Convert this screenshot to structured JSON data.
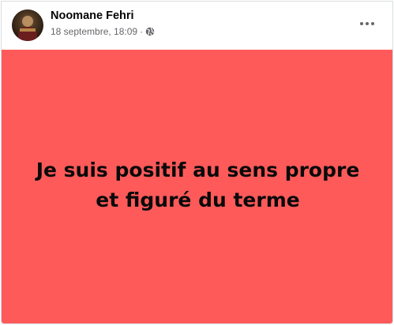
{
  "post": {
    "author": "Noomane Fehri",
    "timestamp": "18 septembre, 18:09",
    "separator": "·",
    "privacy_icon": "globe-icon",
    "more_icon": "more-horizontal-icon",
    "background_color": "#ff5a5a",
    "text_lines": [
      "Je suis positif au sens propre",
      "et figuré du terme"
    ]
  }
}
